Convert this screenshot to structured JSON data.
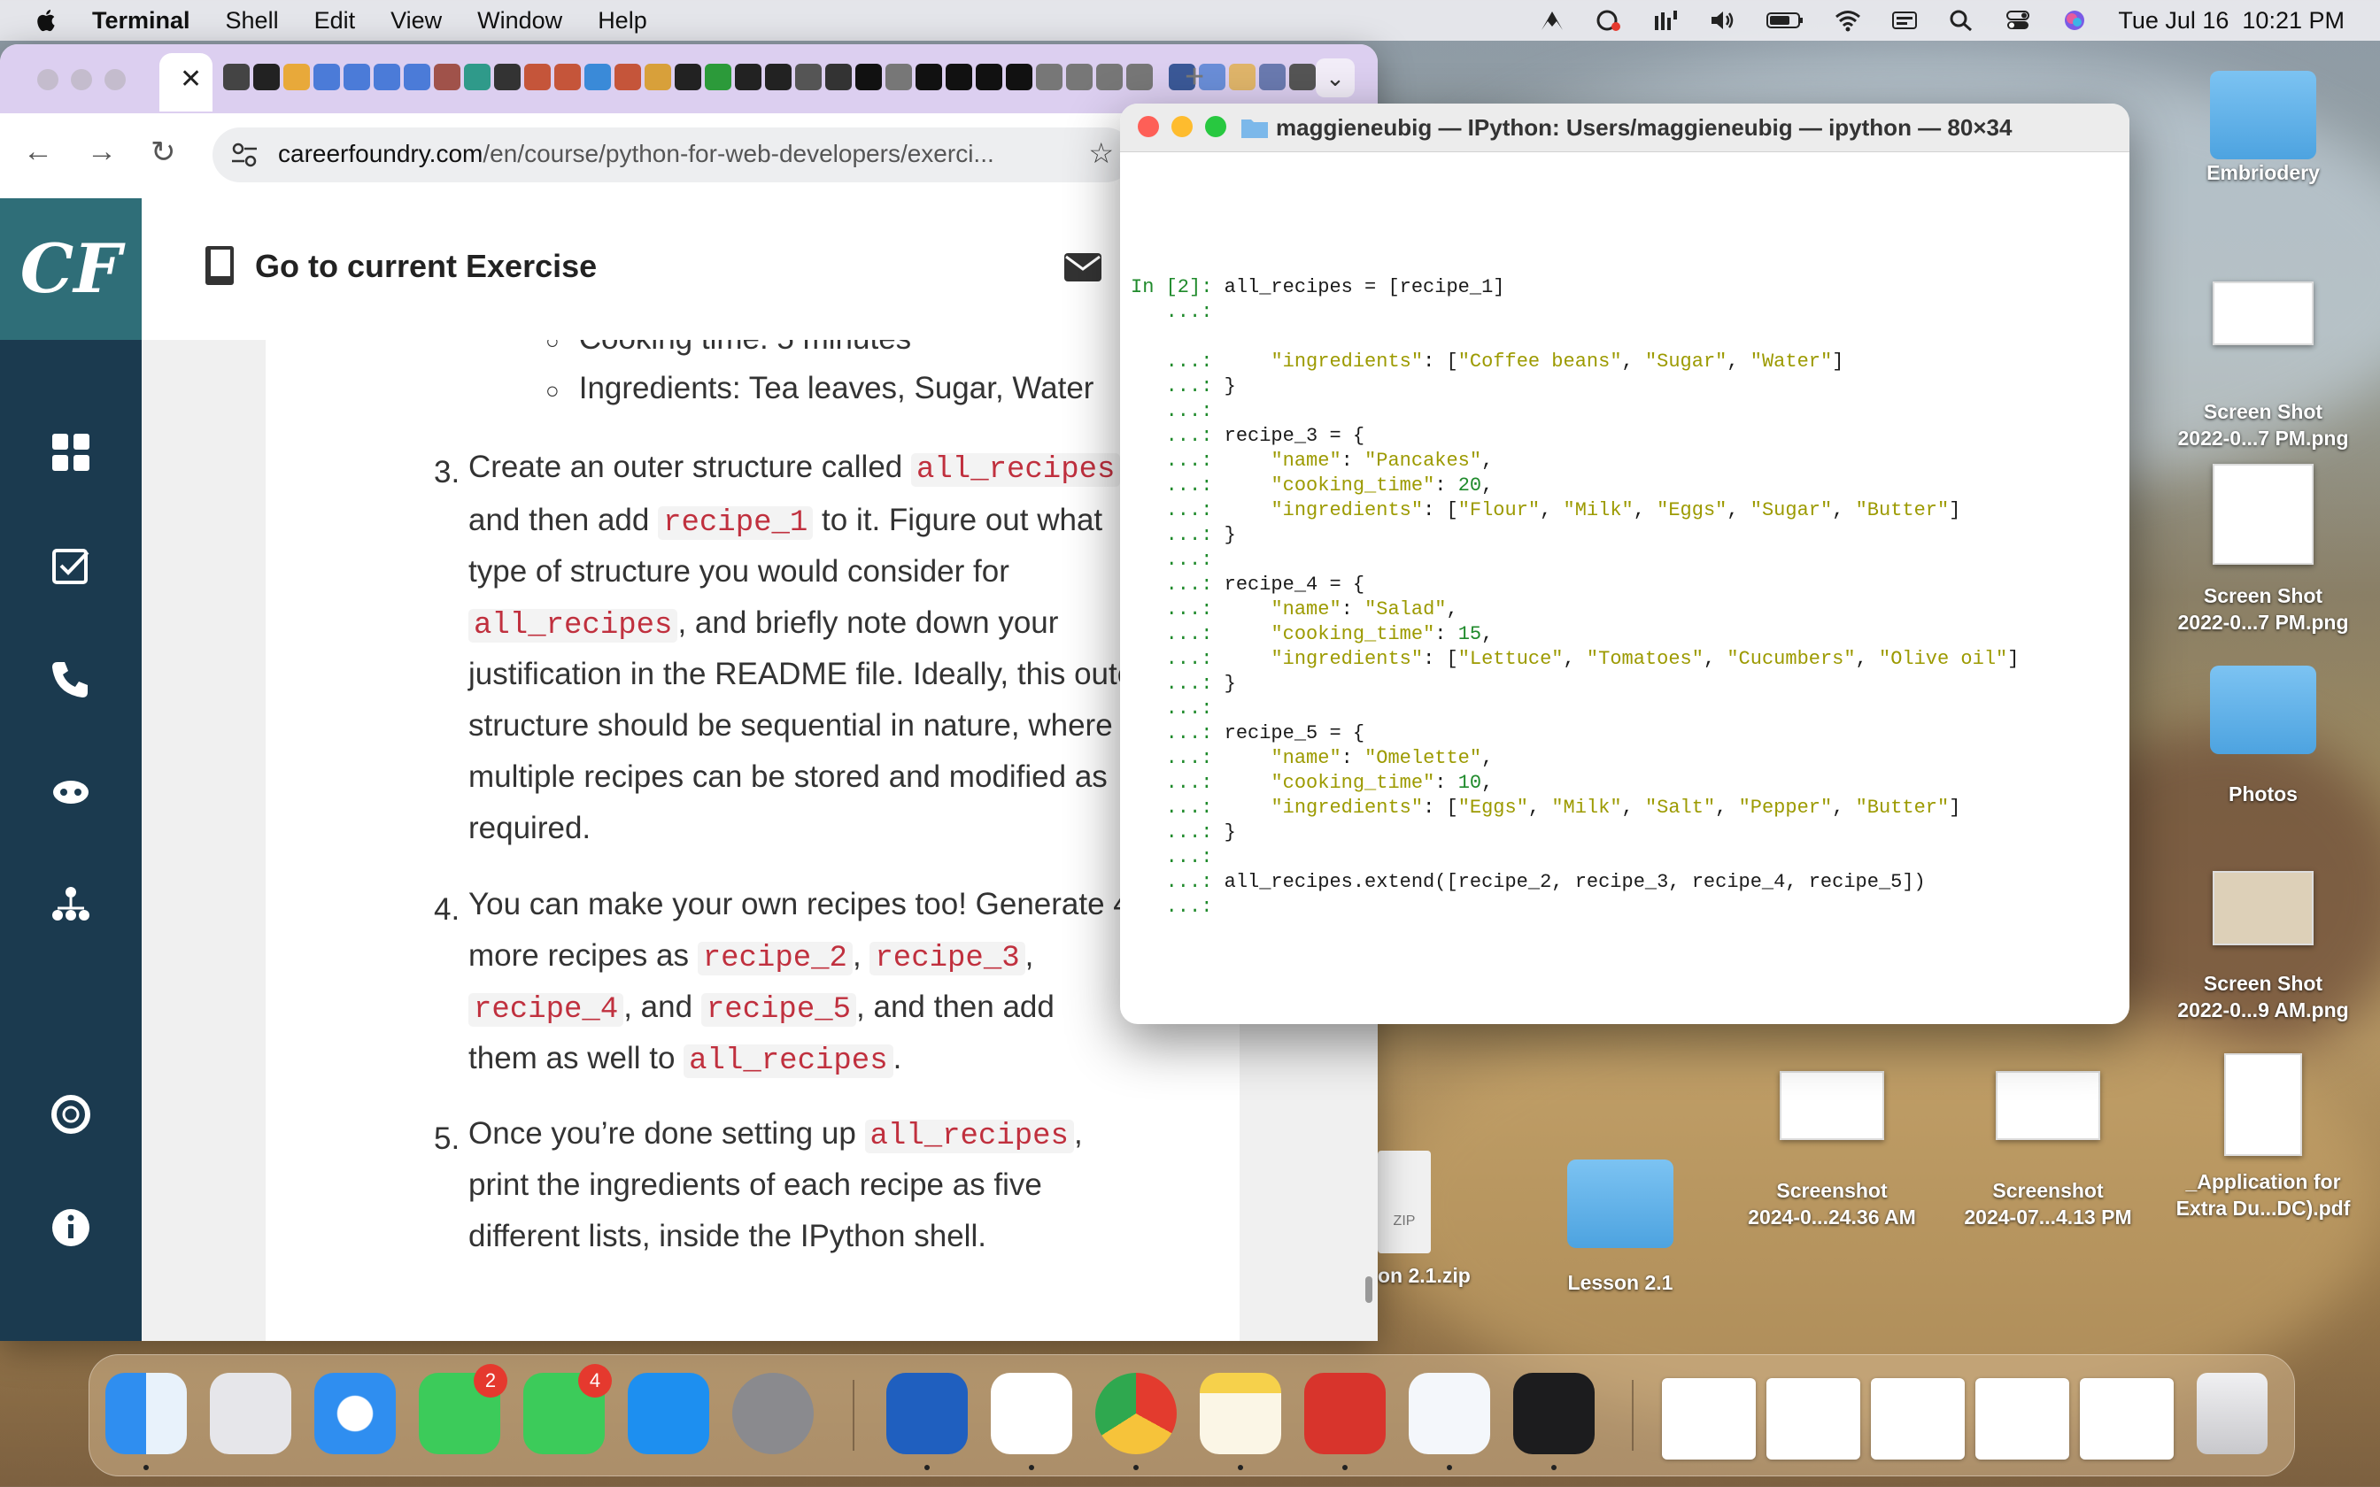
{
  "menubar": {
    "app": "Terminal",
    "items": [
      "Shell",
      "Edit",
      "View",
      "Window",
      "Help"
    ],
    "datetime": "Tue Jul 16  10:21 PM"
  },
  "browser": {
    "url_host": "careerfoundry.com",
    "url_path": "/en/course/python-for-web-developers/exerci...",
    "header_title": "Go to current Exercise",
    "logo": "CF",
    "content": {
      "cooking_time_partial": "Cooking time: 5 minutes",
      "ingredients_bullet": "Ingredients: Tea leaves, Sugar, Water",
      "step3": {
        "num": "3.",
        "a1": "Create an outer structure called ",
        "c1": "all_recipes",
        "b1": "and then add ",
        "c2": "recipe_1",
        "b2": " to it. Figure out what",
        "l3": "type of structure you would consider for",
        "c3": "all_recipes",
        "l4b": ", and briefly note down your",
        "l5": "justification in the README file. Ideally, this oute",
        "l6": "structure should be sequential in nature, where",
        "l7": "multiple recipes can be stored and modified as",
        "l8": "required."
      },
      "step4": {
        "num": "4.",
        "l1": "You can make your own recipes too! Generate 4",
        "l2a": "more recipes as ",
        "c_r2": "recipe_2",
        "comma1": ", ",
        "c_r3": "recipe_3",
        "comma2": ",",
        "c_r4": "recipe_4",
        "and": ", and ",
        "c_r5": "recipe_5",
        "l3b": ", and then add",
        "l4a": "them as well to ",
        "c_all": "all_recipes",
        "period": "."
      },
      "step5": {
        "num": "5.",
        "l1a": "Once you’re done setting up ",
        "c_all": "all_recipes",
        "l1b": ",",
        "l2": "print the ingredients of each recipe as five",
        "l3": "different lists, inside the IPython shell."
      }
    }
  },
  "terminal": {
    "title": "maggieneubig — IPython: Users/maggieneubig — ipython — 80×34",
    "lines": [
      {
        "p": "In [2]: ",
        "t": "all_recipes = [recipe_1]"
      },
      {
        "p": "   ...: ",
        "t": ""
      },
      {
        "p": "",
        "t": ""
      },
      {
        "p": "   ...: ",
        "t": "    \"ingredients\": [\"Coffee beans\", \"Sugar\", \"Water\"]"
      },
      {
        "p": "   ...: ",
        "t": "}"
      },
      {
        "p": "   ...: ",
        "t": ""
      },
      {
        "p": "   ...: ",
        "t": "recipe_3 = {"
      },
      {
        "p": "   ...: ",
        "t": "    \"name\": \"Pancakes\","
      },
      {
        "p": "   ...: ",
        "t": "    \"cooking_time\": 20,"
      },
      {
        "p": "   ...: ",
        "t": "    \"ingredients\": [\"Flour\", \"Milk\", \"Eggs\", \"Sugar\", \"Butter\"]"
      },
      {
        "p": "   ...: ",
        "t": "}"
      },
      {
        "p": "   ...: ",
        "t": ""
      },
      {
        "p": "   ...: ",
        "t": "recipe_4 = {"
      },
      {
        "p": "   ...: ",
        "t": "    \"name\": \"Salad\","
      },
      {
        "p": "   ...: ",
        "t": "    \"cooking_time\": 15,"
      },
      {
        "p": "   ...: ",
        "t": "    \"ingredients\": [\"Lettuce\", \"Tomatoes\", \"Cucumbers\", \"Olive oil\"]"
      },
      {
        "p": "   ...: ",
        "t": "}"
      },
      {
        "p": "   ...: ",
        "t": ""
      },
      {
        "p": "   ...: ",
        "t": "recipe_5 = {"
      },
      {
        "p": "   ...: ",
        "t": "    \"name\": \"Omelette\","
      },
      {
        "p": "   ...: ",
        "t": "    \"cooking_time\": 10,"
      },
      {
        "p": "   ...: ",
        "t": "    \"ingredients\": [\"Eggs\", \"Milk\", \"Salt\", \"Pepper\", \"Butter\"]"
      },
      {
        "p": "   ...: ",
        "t": "}"
      },
      {
        "p": "   ...: ",
        "t": ""
      },
      {
        "p": "   ...: ",
        "t": "all_recipes.extend([recipe_2, recipe_3, recipe_4, recipe_5])"
      },
      {
        "p": "   ...: ",
        "t": ""
      }
    ]
  },
  "desktop": {
    "icons": [
      {
        "l1": "Embriodery",
        "l2": ""
      },
      {
        "l1": "Screen Shot",
        "l2": "2022-0...7 PM.png"
      },
      {
        "l1": "Screen Shot",
        "l2": "2022-0...7 PM.png"
      },
      {
        "l1": "Photos",
        "l2": ""
      },
      {
        "l1": "Screen Shot",
        "l2": "2022-0...9 AM.png"
      },
      {
        "l1": "_Application for",
        "l2": "Extra Du...DC).pdf"
      },
      {
        "l1": "Screenshot",
        "l2": "2024-0...24.36 AM"
      },
      {
        "l1": "Screenshot",
        "l2": "2024-07...4.13 PM"
      },
      {
        "l1": "Lesson 2.1",
        "l2": ""
      },
      {
        "l1": "on 2.1.zip",
        "l2": ""
      }
    ],
    "zip_label": "ZIP"
  },
  "dock": {
    "facetime_badge": "2",
    "messages_badge": "4"
  },
  "colors": {
    "sidebar": "#1b3a4f",
    "logo_bg": "#2f6e78",
    "code_red": "#c0303e",
    "prompt_green": "#1f8a2b",
    "string_olive": "#9c9a00",
    "tab_bar": "#dccff0"
  }
}
